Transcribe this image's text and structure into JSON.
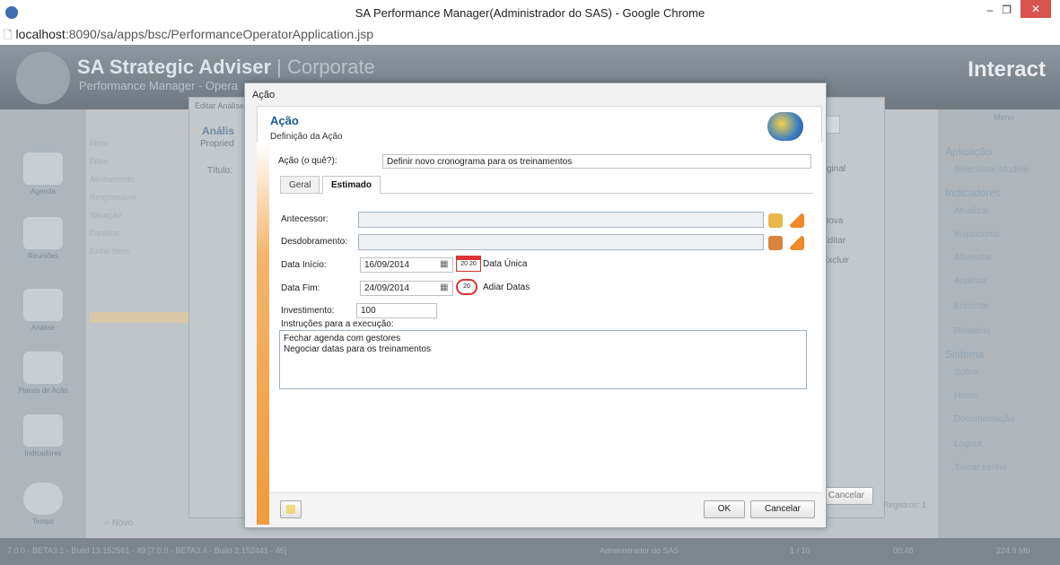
{
  "browser": {
    "title": "SA Performance Manager(Administrador do SAS) - Google Chrome",
    "url_host": "localhost",
    "url_path": ":8090/sa/apps/bsc/PerformanceOperatorApplication.jsp"
  },
  "app": {
    "title": "SA Strategic Adviser",
    "edition": "| Corporate",
    "subtitle": "Performance Manager - Opera",
    "logo": "Interact",
    "menu_label": "Menu",
    "left_nav": [
      "Agenda",
      "Reuniões",
      "Análise",
      "Planos de Ação",
      "Indicadores",
      "Tempo"
    ],
    "right_sections": {
      "aplicacao": "Aplicação",
      "indicadores": "Indicadores",
      "sistema": "Sistema"
    },
    "right_items": {
      "aplicacao": [
        "Selecionar Modelo"
      ],
      "indicadores": [
        "Atualizar",
        "Inspecionar",
        "Alimentar",
        "Analisar",
        "Encerrar",
        "Relatório"
      ],
      "sistema": [
        "Sobre",
        "Home",
        "Documentação",
        "Logout",
        "Trocar senha"
      ]
    },
    "bg_fields": [
      "Filtro",
      "Filtro",
      "Alinhamento",
      "Responsável",
      "Situação",
      "Farol/os",
      "Exibir itens"
    ],
    "bg_novo": "Novo",
    "status": {
      "version": "7.0.0 - BETA3.1 - Build 13.152561 - 49 [7.0.0 - BETA3.4 - Build 2.152441 - 45]",
      "user": "Administrador do SAS",
      "page": "1 / 10",
      "time": "00:48",
      "memory": "224.9 Mb"
    }
  },
  "window2": {
    "title": "Editar Análise",
    "heading": "Anális",
    "props": "Propried",
    "titulo_label": "Título:",
    "side_links": [
      "Nova",
      "Editar",
      "Excluir"
    ],
    "original": "ginal",
    "cancel": "Cancelar",
    "registros": "Registros: 1"
  },
  "dialog": {
    "title": "Ação",
    "header": "Ação",
    "subheader": "Definição da Ação",
    "acao_label": "Ação (o quê?):",
    "acao_value": "Definir novo cronograma para os treinamentos",
    "tabs": [
      "Geral",
      "Estimado"
    ],
    "antecessor_label": "Antecessor:",
    "antecessor_value": "",
    "desdobramento_label": "Desdobramento:",
    "desdobramento_value": "",
    "data_inicio_label": "Data Início:",
    "data_inicio_value": "16/09/2014",
    "data_unica_label": "Data Única",
    "data_fim_label": "Data Fim:",
    "data_fim_value": "24/09/2014",
    "adiar_label": "Adiar Datas",
    "investimento_label": "Investimento:",
    "investimento_value": "100",
    "instrucoes_label": "Instruções para a execução:",
    "instrucoes_value": "Fechar agenda com gestores\nNegociar datas para os treinamentos",
    "ok": "OK",
    "cancelar": "Cancelar"
  }
}
